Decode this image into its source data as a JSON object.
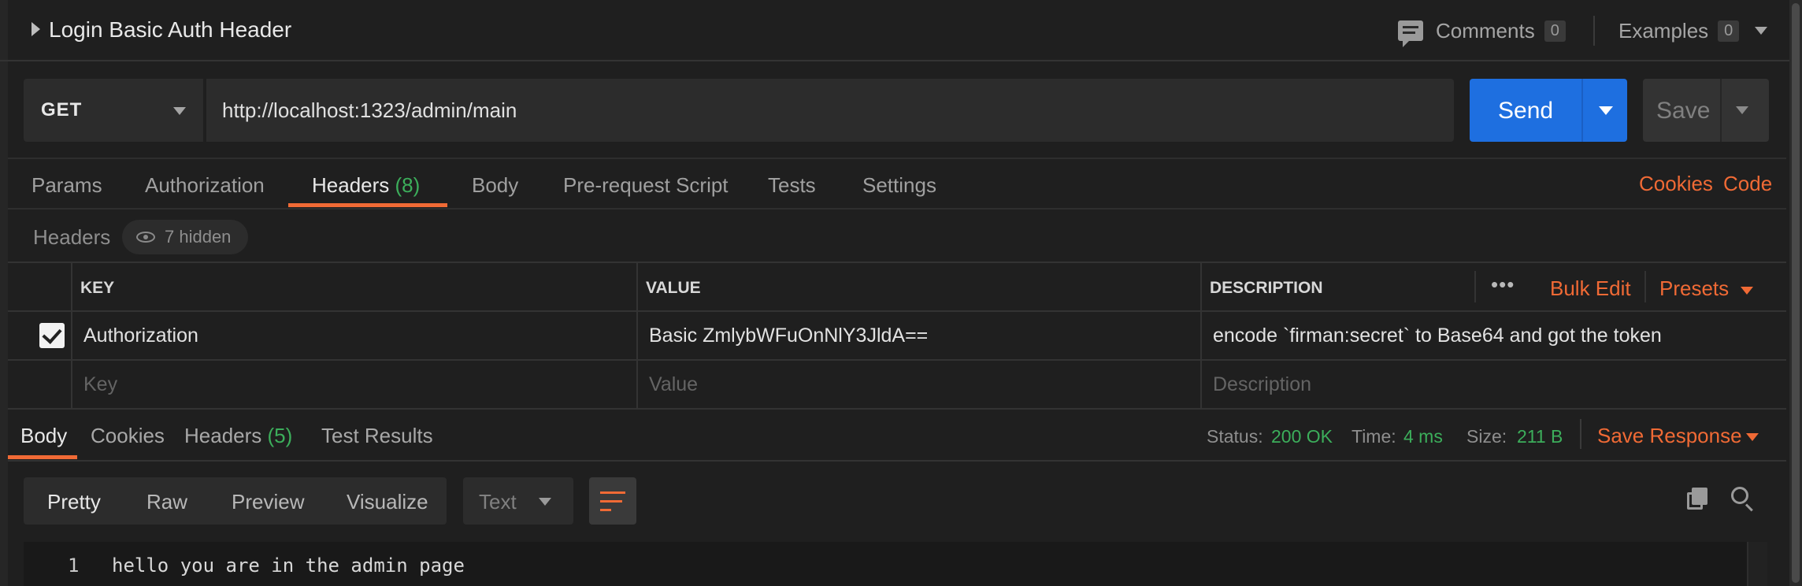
{
  "request": {
    "title": "Login Basic Auth Header",
    "comments_label": "Comments",
    "comments_count": "0",
    "examples_label": "Examples",
    "examples_count": "0"
  },
  "urlbar": {
    "method": "GET",
    "url": "http://localhost:1323/admin/main",
    "send_label": "Send",
    "save_label": "Save"
  },
  "tabs": {
    "params": "Params",
    "authorization": "Authorization",
    "headers": "Headers",
    "headers_count": "(8)",
    "body": "Body",
    "prerequest": "Pre-request Script",
    "tests": "Tests",
    "settings": "Settings",
    "cookies_link": "Cookies",
    "code_link": "Code"
  },
  "headers_section": {
    "label": "Headers",
    "hidden": "7 hidden",
    "columns": {
      "key": "KEY",
      "value": "VALUE",
      "description": "DESCRIPTION"
    },
    "more": "•••",
    "bulk_edit": "Bulk Edit",
    "presets": "Presets",
    "rows": [
      {
        "checked": true,
        "key": "Authorization",
        "value": "Basic ZmlybWFuOnNlY3JldA==",
        "description": "encode `firman:secret` to Base64 and got the token"
      }
    ],
    "placeholders": {
      "key": "Key",
      "value": "Value",
      "description": "Description"
    }
  },
  "response": {
    "tabs": {
      "body": "Body",
      "cookies": "Cookies",
      "headers": "Headers",
      "headers_count": "(5)",
      "test_results": "Test Results"
    },
    "status_label": "Status:",
    "status_value": "200 OK",
    "time_label": "Time:",
    "time_value": "4 ms",
    "size_label": "Size:",
    "size_value": "211 B",
    "save_response": "Save Response",
    "views": {
      "pretty": "Pretty",
      "raw": "Raw",
      "preview": "Preview",
      "visualize": "Visualize"
    },
    "format": "Text",
    "lines": [
      {
        "number": "1",
        "text": "hello you are in the admin page"
      }
    ]
  },
  "colors": {
    "accent": "#f06a35",
    "send": "#1e6fe0",
    "success": "#3cae5b"
  }
}
